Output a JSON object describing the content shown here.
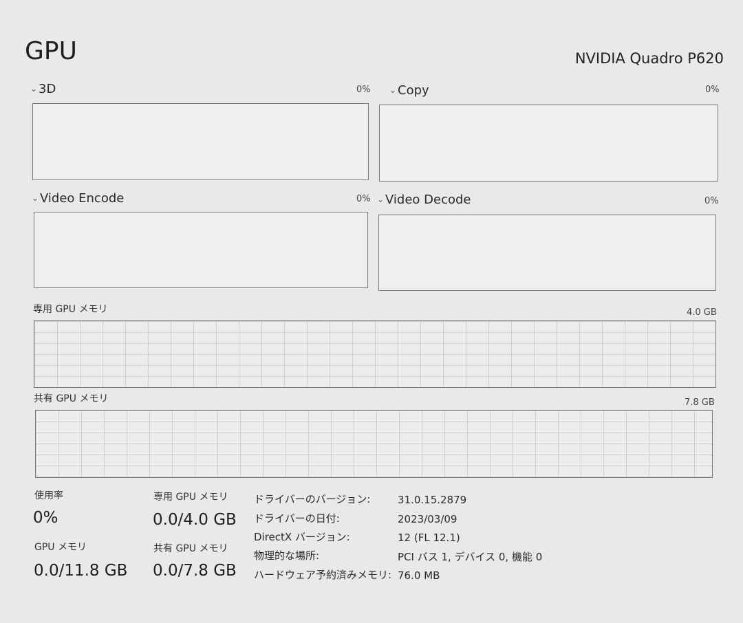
{
  "header": {
    "title": "GPU",
    "device_name": "NVIDIA Quadro P620"
  },
  "engines": [
    {
      "label": "3D",
      "value": "0%"
    },
    {
      "label": "Copy",
      "value": "0%"
    },
    {
      "label": "Video Encode",
      "value": "0%"
    },
    {
      "label": "Video Decode",
      "value": "0%"
    }
  ],
  "memory_graphs": [
    {
      "label": "専用 GPU メモリ",
      "value": "4.0 GB"
    },
    {
      "label": "共有 GPU メモリ",
      "value": "7.8 GB"
    }
  ],
  "stats": {
    "utilization": {
      "label": "使用率",
      "value": "0%"
    },
    "dedicated": {
      "label": "専用 GPU メモリ",
      "value": "0.0/4.0 GB"
    },
    "gpu_memory": {
      "label": "GPU メモリ",
      "value": "0.0/11.8 GB"
    },
    "shared": {
      "label": "共有 GPU メモリ",
      "value": "0.0/7.8 GB"
    }
  },
  "info": [
    {
      "label": "ドライバーのバージョン:",
      "value": "31.0.15.2879"
    },
    {
      "label": "ドライバーの日付:",
      "value": "2023/03/09"
    },
    {
      "label": "DirectX バージョン:",
      "value": "12 (FL 12.1)"
    },
    {
      "label": "物理的な場所:",
      "value": "PCI バス 1, デバイス 0, 機能 0"
    },
    {
      "label": "ハードウェア予約済みメモリ:",
      "value": "76.0 MB"
    }
  ],
  "icons": {
    "chevron": "chevron-down-icon",
    "chevron_glyph": "⌄"
  }
}
